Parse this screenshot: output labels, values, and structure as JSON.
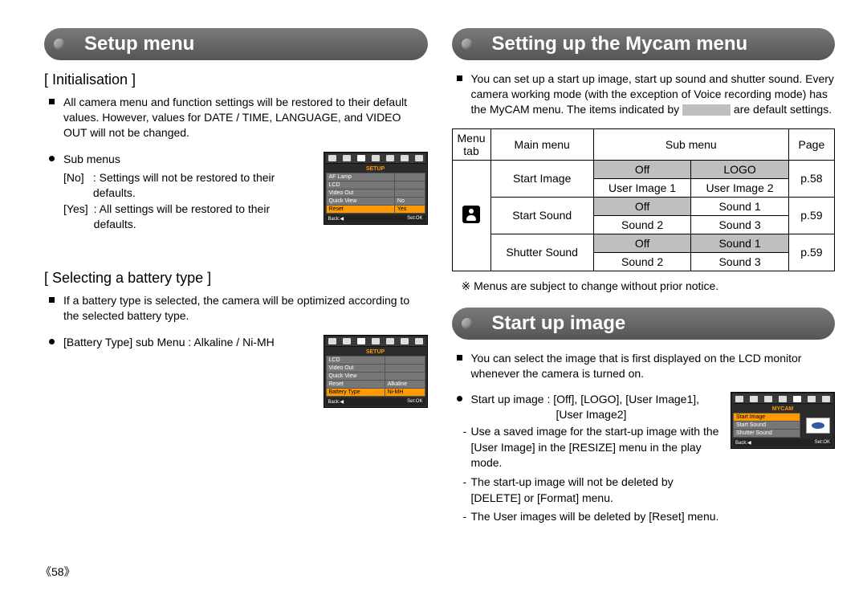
{
  "leftCol": {
    "heading": "Setup menu",
    "init": {
      "title": "[ Initialisation ]",
      "intro": "All camera menu and function settings will be restored to their default values. However, values for DATE / TIME, LANGUAGE, and VIDEO OUT will not be changed.",
      "subMenusLabel": "Sub menus",
      "noKey": "[No]",
      "noDesc": ": Settings will not be restored to their defaults.",
      "yesKey": "[Yes]",
      "yesDesc": ": All settings will be restored to their defaults.",
      "lcd": {
        "title": "SETUP",
        "rows": [
          "AF Lamp",
          "LCD",
          "Video Out",
          "Quick View",
          "Reset"
        ],
        "col1": [
          "",
          "",
          "",
          "No",
          "Yes"
        ],
        "selIndex": 4,
        "back": "Back:◀",
        "set": "Set:OK"
      }
    },
    "battery": {
      "title": "[ Selecting a battery type ]",
      "intro": "If a battery type is selected, the camera will be optimized according to the selected battery type.",
      "line": "[Battery Type] sub Menu : Alkaline / Ni-MH",
      "lcd": {
        "title": "SETUP",
        "rows": [
          "LCD",
          "Video Out",
          "Quick View",
          "Reset",
          "Battery Type"
        ],
        "col1": [
          "",
          "",
          "",
          "Alkaline",
          "Ni-MH"
        ],
        "selIndex": 4,
        "back": "Back:◀",
        "set": "Set:OK"
      }
    }
  },
  "rightCol": {
    "heading1": "Setting up the Mycam menu",
    "mycamIntro1": "You can set up a start up image, start up sound and shutter sound. Every camera working mode (with the exception of Voice recording mode) has the MyCAM menu. The items indicated by",
    "mycamIntro2": "are default settings.",
    "table": {
      "head": [
        "Menu tab",
        "Main menu",
        "Sub menu",
        "Page"
      ],
      "mainMenus": [
        "Start Image",
        "Start Sound",
        "Shutter Sound"
      ],
      "pages": [
        "p.58",
        "p.59",
        "p.59"
      ],
      "sub": {
        "r1": [
          "Off",
          "LOGO"
        ],
        "r2": [
          "User Image 1",
          "User Image 2"
        ],
        "r3": [
          "Off",
          "Sound 1"
        ],
        "r4": [
          "Sound 2",
          "Sound 3"
        ],
        "r5": [
          "Off",
          "Sound 1"
        ],
        "r6": [
          "Sound 2",
          "Sound 3"
        ]
      }
    },
    "noteMark": "※",
    "noteText": "Menus are subject to change without prior notice.",
    "heading2": "Start up image",
    "startImgIntro": "You can select the image that is first displayed on the LCD monitor whenever the camera is turned on.",
    "startImgLine1": "Start up image : [Off], [LOGO], [User Image1],",
    "startImgLine1b": "[User Image2]",
    "bullets": [
      "Use a saved image for the start-up image with the [User Image] in the [RESIZE] menu in the play mode.",
      "The start-up image will not be deleted by [DELETE] or [Format] menu.",
      "The User images will be deleted by [Reset] menu."
    ],
    "mycamLcd": {
      "title": "MYCAM",
      "rows": [
        "Start Image",
        "Start Sound",
        "Shutter Sound"
      ],
      "back": "Back:◀",
      "set": "Set:OK"
    }
  },
  "pageNumber": "《58》"
}
